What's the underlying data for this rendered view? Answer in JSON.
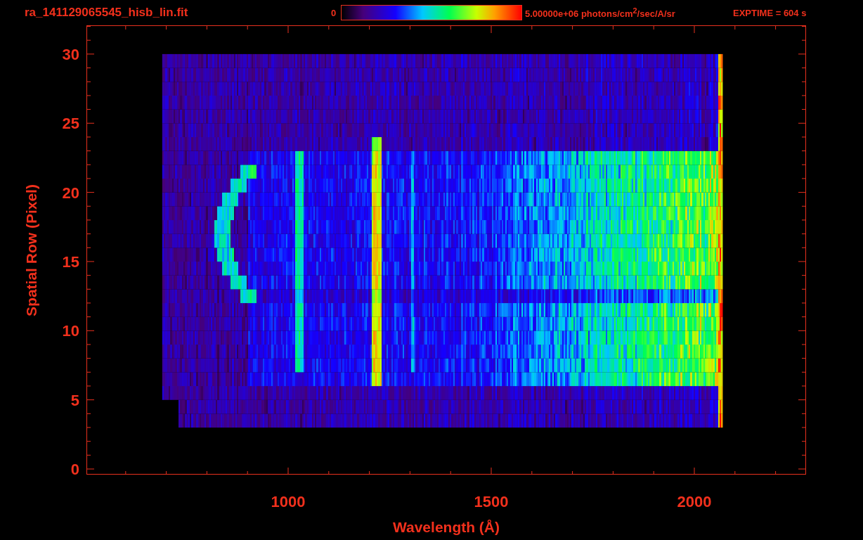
{
  "plot": {
    "title": "ra_141129065545_hisb_lin.fit",
    "colorbar": {
      "min_label": "0",
      "max_label": "5.00000e+06 photons/cm$^{2}$/sec/A/sr"
    },
    "exposure": "EXPTIME = 604 s",
    "xlabel": "Wavelength (Å)",
    "ylabel": "Spatial Row (Pixel)",
    "xticks": [
      "1000",
      "1500",
      "2000"
    ],
    "yticks": [
      "30",
      "25",
      "20",
      "15",
      "10",
      "5",
      "0"
    ]
  }
}
